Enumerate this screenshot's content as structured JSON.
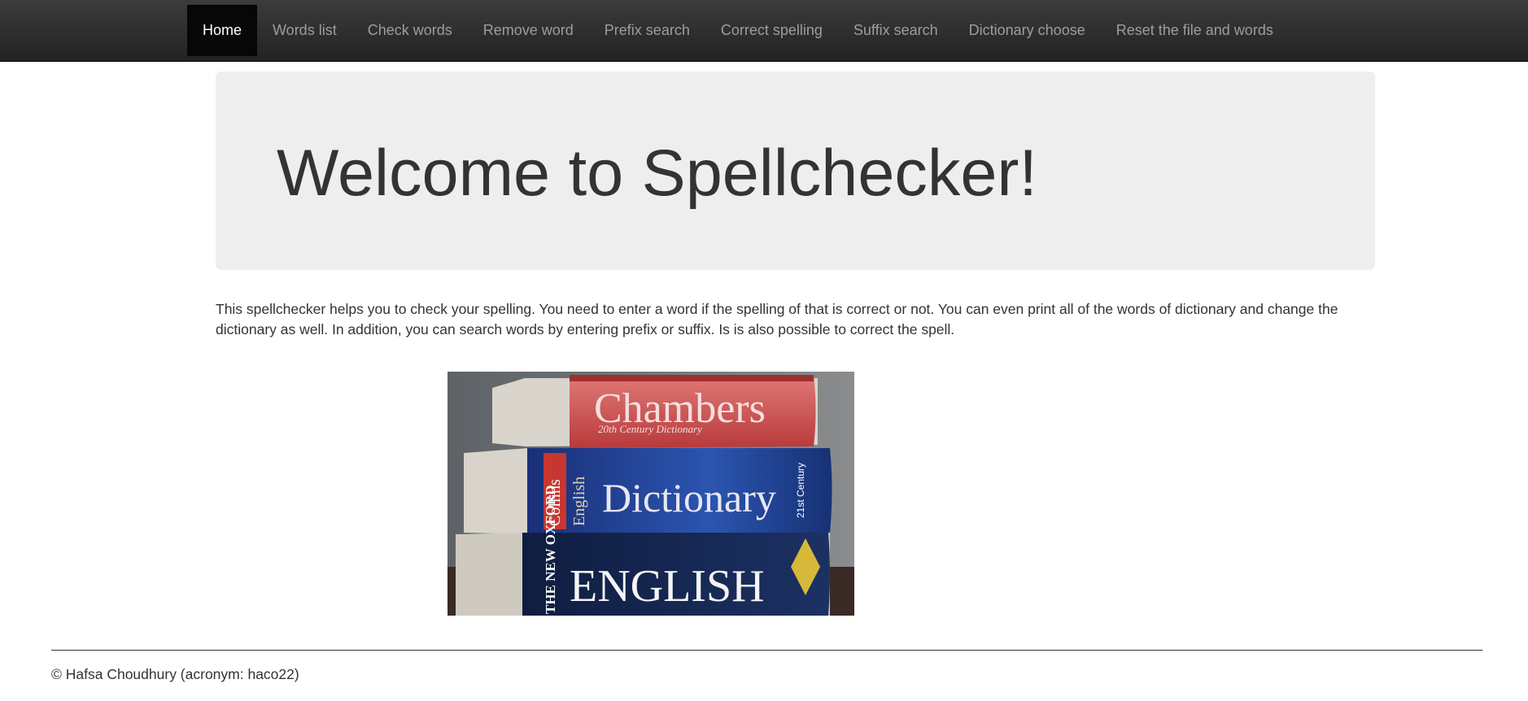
{
  "nav": {
    "items": [
      {
        "label": "Home",
        "active": true
      },
      {
        "label": "Words list"
      },
      {
        "label": "Check words"
      },
      {
        "label": "Remove word"
      },
      {
        "label": "Prefix search"
      },
      {
        "label": "Correct spelling"
      },
      {
        "label": "Suffix search"
      },
      {
        "label": "Dictionary choose"
      },
      {
        "label": "Reset the file and words"
      }
    ]
  },
  "hero": {
    "title": "Welcome to Spellchecker!"
  },
  "intro": {
    "text": "This spellchecker helps you to check your spelling. You need to enter a word if the spelling of that is correct or not. You can even print all of the words of dictionary and change the dictionary as well. In addition, you can search words by entering prefix or suffix. Is is also possible to correct the spell."
  },
  "image": {
    "book_top_title": "Chambers",
    "book_top_subtitle": "20th Century Dictionary",
    "book_middle_brand": "Collins",
    "book_middle_side": "English",
    "book_middle_title": "Dictionary",
    "book_middle_badge": "21st Century",
    "book_bottom_side": "THE NEW OXFORD",
    "book_bottom_title": "ENGLISH",
    "colors": {
      "red_book": "#c94a4a",
      "blue_book": "#1f3f8f",
      "navy_book": "#14264f"
    }
  },
  "footer": {
    "text": "© Hafsa Choudhury (acronym: haco22)"
  }
}
